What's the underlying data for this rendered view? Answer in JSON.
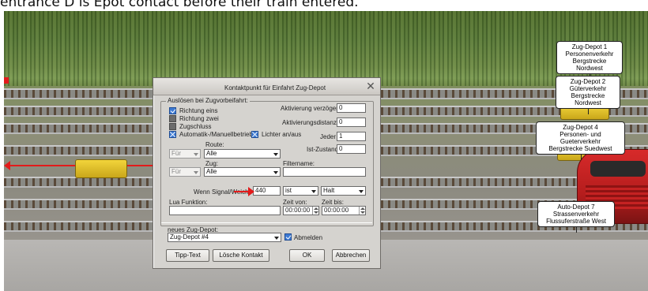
{
  "caption": "entrance D is Epot contact before their train entered.",
  "dialog": {
    "title": "Kontaktpunkt für Einfahrt Zug-Depot",
    "close_icon": "close-icon",
    "trigger_group": "Auslösen bei Zugvorbeifahrt:",
    "checks": {
      "richtung_eins": "Richtung eins",
      "richtung_zwei": "Richtung zwei",
      "zugschluss": "Zugschluss",
      "automatik": "Automatik-/Manuellbetrieb",
      "lichter": "Lichter an/aus"
    },
    "aktivierung_verzoegert_label": "Aktivierung verzögert",
    "aktivierung_verzoegert_value": "0",
    "aktivierungsdistanz_label": "Aktivierungsdistanz",
    "aktivierungsdistanz_value": "0",
    "jeder_label": "Jeder",
    "jeder_value": "1",
    "ist_zustand_label": "Ist-Zustand",
    "ist_zustand_value": "0",
    "route_label": "Route:",
    "route_filter": "Für",
    "route_value": "Alle",
    "zug_label": "Zug:",
    "zug_filter": "Für",
    "zug_value": "Alle",
    "filtername_label": "Filtername:",
    "filtername_value": "",
    "signal_label": "Wenn Signal/Weiche",
    "signal_value": "440",
    "signal_cond": "ist",
    "signal_state": "Halt",
    "lua_label": "Lua Funktion:",
    "lua_value": "",
    "zeit_von_label": "Zeit von:",
    "zeit_von_value": "00:00:00",
    "zeit_bis_label": "Zeit bis:",
    "zeit_bis_value": "00:00:00",
    "depot_label": "neues Zug-Depot:",
    "depot_value": "Zug-Depot #4",
    "abmelden_label": "Abmelden",
    "buttons": {
      "tipp_text": "Tipp-Text",
      "loesche_kontakt": "Lösche Kontakt",
      "ok": "OK",
      "abbrechen": "Abbrechen"
    }
  },
  "labels": {
    "depot1": [
      "Zug-Depot 1",
      "Personenverkehr",
      "Bergstrecke Nordwest"
    ],
    "depot2": [
      "Zug-Depot 2",
      "Güterverkehr",
      "Bergstrecke Nordwest"
    ],
    "depot4": [
      "Zug-Depot 4",
      "Personen- und Gueterverkehr",
      "Bergstrecke Suedwest"
    ],
    "depot7": [
      "Auto-Depot 7",
      "Strassenverkehr",
      "Flussuferstraße West"
    ]
  },
  "colors": {
    "annotation_red": "#e21b1b",
    "check_blue": "#3e7bd4"
  }
}
